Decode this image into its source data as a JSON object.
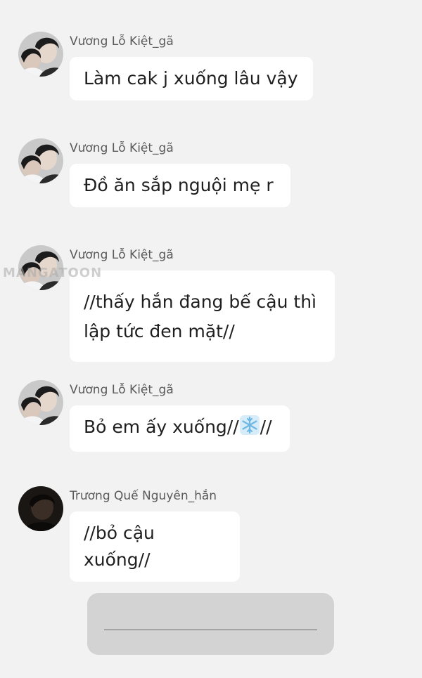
{
  "watermark": "MANGATOON",
  "messages": [
    {
      "sender": "Vương Lỗ Kiệt_gã",
      "text": "Làm cak j xuống lâu vậy"
    },
    {
      "sender": "Vương Lỗ Kiệt_gã",
      "text": "Đồ ăn sắp nguội mẹ r"
    },
    {
      "sender": "Vương Lỗ Kiệt_gã",
      "text": "//thấy hắn đang bế cậu thì\nlập tức đen mặt//"
    },
    {
      "sender": "Vương Lỗ Kiệt_gã",
      "text_before": "Bỏ em ấy xuống//",
      "emoji": "snowflake-icon",
      "text_after": "//"
    },
    {
      "sender": "Trương Quế Nguyên_hắn",
      "text": "//bỏ cậu xuống//"
    }
  ],
  "input": {
    "blank": "_______________________"
  }
}
